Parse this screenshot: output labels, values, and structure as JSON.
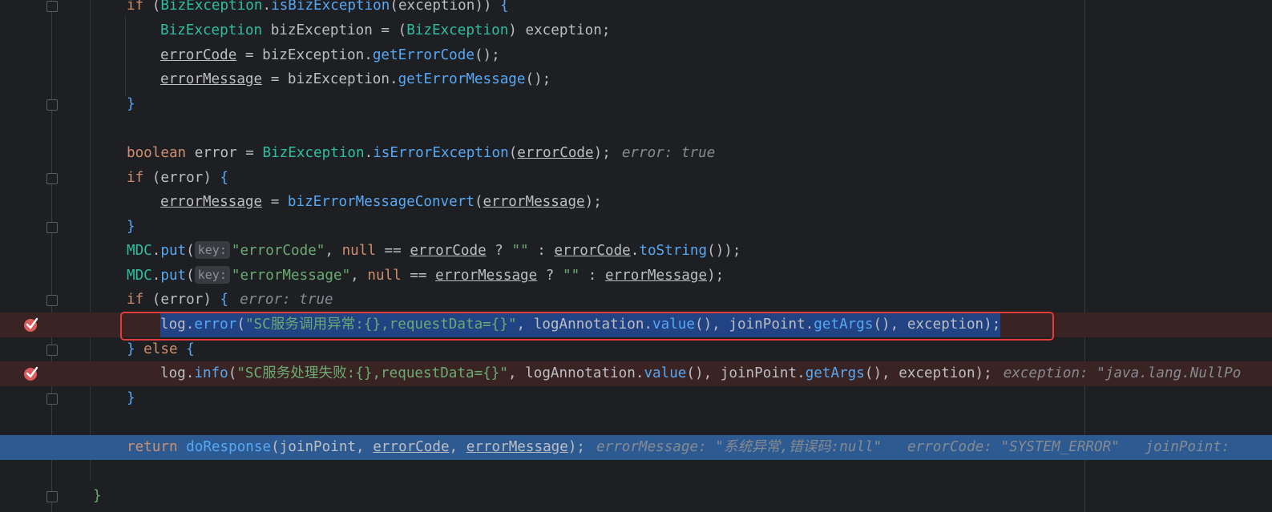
{
  "editor": {
    "lines": [
      {
        "id": "l1",
        "parts": [
          [
            "kw",
            "if "
          ],
          [
            "p",
            "("
          ],
          [
            "type",
            "BizException"
          ],
          [
            "p",
            "."
          ],
          [
            "fn2",
            "isBizException"
          ],
          [
            "p",
            "("
          ],
          [
            "v",
            "exception"
          ],
          [
            "p",
            "))"
          ],
          [
            "p",
            " "
          ],
          [
            "brace",
            "{"
          ]
        ]
      },
      {
        "id": "l2",
        "parts": [
          [
            "type",
            "BizException"
          ],
          [
            "p",
            " bizException = "
          ],
          [
            "p",
            "("
          ],
          [
            "type",
            "BizException"
          ],
          [
            "p",
            ") exception;"
          ]
        ]
      },
      {
        "id": "l3",
        "parts": [
          [
            "lvar",
            "errorCode"
          ],
          [
            "p",
            " = bizException."
          ],
          [
            "fn2",
            "getErrorCode"
          ],
          [
            "p",
            "();"
          ]
        ]
      },
      {
        "id": "l4",
        "parts": [
          [
            "lvar",
            "errorMessage"
          ],
          [
            "p",
            " = bizException."
          ],
          [
            "fn2",
            "getErrorMessage"
          ],
          [
            "p",
            "();"
          ]
        ]
      },
      {
        "id": "l5",
        "parts": [
          [
            "brace",
            "}"
          ]
        ]
      },
      {
        "id": "l6",
        "parts": []
      },
      {
        "id": "l7",
        "parts": [
          [
            "kw",
            "boolean"
          ],
          [
            "p",
            " error = "
          ],
          [
            "type",
            "BizException"
          ],
          [
            "p",
            "."
          ],
          [
            "fn2",
            "isErrorException"
          ],
          [
            "p",
            "("
          ],
          [
            "lvar",
            "errorCode"
          ],
          [
            "p",
            ");"
          ]
        ],
        "hint": "error: true"
      },
      {
        "id": "l8",
        "parts": [
          [
            "kw",
            "if "
          ],
          [
            "p",
            "(error) "
          ],
          [
            "brace",
            "{"
          ]
        ]
      },
      {
        "id": "l9",
        "parts": [
          [
            "lvar",
            "errorMessage"
          ],
          [
            "p",
            " = "
          ],
          [
            "fn2",
            "bizErrorMessageConvert"
          ],
          [
            "p",
            "("
          ],
          [
            "lvar",
            "errorMessage"
          ],
          [
            "p",
            ");"
          ]
        ]
      },
      {
        "id": "l10",
        "parts": [
          [
            "brace",
            "}"
          ]
        ]
      },
      {
        "id": "l11",
        "parts": [
          [
            "type",
            "MDC"
          ],
          [
            "p",
            "."
          ],
          [
            "fn2",
            "put"
          ],
          [
            "p",
            "("
          ],
          [
            "phint",
            "key:"
          ],
          [
            "str",
            "\"errorCode\""
          ],
          [
            "p",
            ", "
          ],
          [
            "kw",
            "null"
          ],
          [
            "p",
            " == "
          ],
          [
            "lvar",
            "errorCode"
          ],
          [
            "p",
            " ? "
          ],
          [
            "str",
            "\"\""
          ],
          [
            "p",
            " : "
          ],
          [
            "lvar",
            "errorCode"
          ],
          [
            "p",
            "."
          ],
          [
            "fn2",
            "toString"
          ],
          [
            "p",
            "());"
          ]
        ]
      },
      {
        "id": "l12",
        "parts": [
          [
            "type",
            "MDC"
          ],
          [
            "p",
            "."
          ],
          [
            "fn2",
            "put"
          ],
          [
            "p",
            "("
          ],
          [
            "phint",
            "key:"
          ],
          [
            "str",
            "\"errorMessage\""
          ],
          [
            "p",
            ", "
          ],
          [
            "kw",
            "null"
          ],
          [
            "p",
            " == "
          ],
          [
            "lvar",
            "errorMessage"
          ],
          [
            "p",
            " ? "
          ],
          [
            "str",
            "\"\""
          ],
          [
            "p",
            " : "
          ],
          [
            "lvar",
            "errorMessage"
          ],
          [
            "p",
            ");"
          ]
        ]
      },
      {
        "id": "l13",
        "parts": [
          [
            "kw",
            "if "
          ],
          [
            "p",
            "(error) "
          ],
          [
            "brace",
            "{"
          ]
        ],
        "hint": "error: true"
      },
      {
        "id": "l14",
        "parts": [
          [
            "v",
            "log"
          ],
          [
            "p",
            "."
          ],
          [
            "fn2",
            "error"
          ],
          [
            "p",
            "("
          ],
          [
            "str",
            "\"SC服务调用异常:{},requestData={}\""
          ],
          [
            "p",
            ", logAnnotation."
          ],
          [
            "fn2",
            "value"
          ],
          [
            "p",
            "(), joinPoint."
          ],
          [
            "fn2",
            "getArgs"
          ],
          [
            "p",
            "(), exception);"
          ]
        ],
        "selected": true
      },
      {
        "id": "l15",
        "parts": [
          [
            "brace",
            "}"
          ],
          [
            "kw",
            " else "
          ],
          [
            "brace",
            "{"
          ]
        ]
      },
      {
        "id": "l16",
        "parts": [
          [
            "v",
            "log"
          ],
          [
            "p",
            "."
          ],
          [
            "fn2",
            "info"
          ],
          [
            "p",
            "("
          ],
          [
            "str",
            "\"SC服务处理失败:{},requestData={}\""
          ],
          [
            "p",
            ", logAnnotation."
          ],
          [
            "fn2",
            "value"
          ],
          [
            "p",
            "(), joinPoint."
          ],
          [
            "fn2",
            "getArgs"
          ],
          [
            "p",
            "(), exception);"
          ]
        ],
        "hint": "exception: \"java.lang.NullPo"
      },
      {
        "id": "l17",
        "parts": [
          [
            "brace",
            "}"
          ]
        ]
      },
      {
        "id": "l18",
        "parts": []
      },
      {
        "id": "l19",
        "parts": [
          [
            "kw",
            "return "
          ],
          [
            "fn2",
            "doResponse"
          ],
          [
            "p",
            "(joinPoint, "
          ],
          [
            "lvar",
            "errorCode"
          ],
          [
            "p",
            ", "
          ],
          [
            "lvar",
            "errorMessage"
          ],
          [
            "p",
            ");"
          ]
        ],
        "hint": "errorMessage: \"系统异常,错误码:null\"   errorCode: \"SYSTEM_ERROR\"   joinPoint: "
      },
      {
        "id": "l20",
        "parts": []
      },
      {
        "id": "l21",
        "parts": [
          [
            "brace2",
            "}"
          ]
        ]
      }
    ]
  },
  "colors": {
    "background": "#1e1f22",
    "keyword": "#cf8e6d",
    "type": "#2fbfa0",
    "method": "#56a8f5",
    "string": "#6aab73",
    "breakpoint_line": "#3a2323",
    "execution_line": "#2d5a91",
    "highlight_box": "#e33b3b"
  },
  "icons": {
    "breakpoint": "breakpoint-checked-icon",
    "fold": "fold-marker-icon"
  }
}
